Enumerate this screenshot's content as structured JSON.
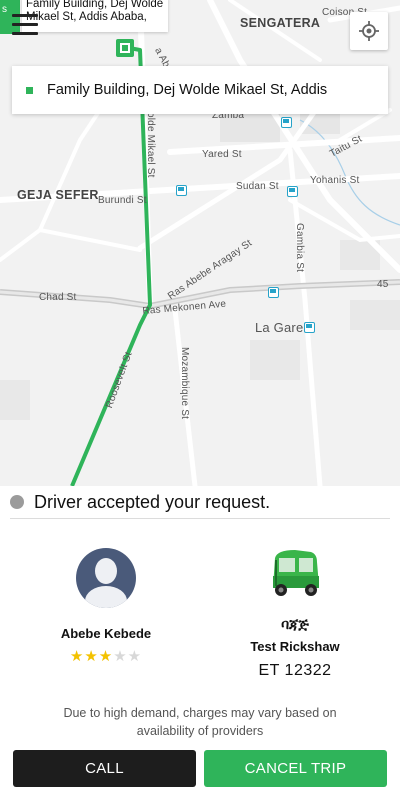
{
  "map": {
    "top_bubble_text": "Family Building, Dej Wolde Mikael St, Addis Ababa,",
    "green_tab_text": "s",
    "labels": {
      "sengatera": "SENGATERA",
      "coison": "Coison St",
      "geja_sefer": "GEJA SEFER",
      "yared": "Yared St",
      "taitu": "Taitu St",
      "sudan": "Sudan St",
      "yohanis": "Yohanis St",
      "burundi": "Burundi St",
      "wolde_mikael": "olde Mikael St",
      "gambia": "Gambia St",
      "ras_abebe": "Ras Abebe Aragay St",
      "chad": "Chad St",
      "ras_mekonen": "Ras Mekonen Ave",
      "route_45": "45",
      "la_gare": "La Gare",
      "mozambique": "Mozambique St",
      "roosevelt": "Roosevelt St",
      "aba_k": "a Aba K",
      "zamba": "Zamba"
    }
  },
  "pickup": {
    "address": "Family Building, Dej Wolde Mikael St, Addis"
  },
  "status": {
    "text": "Driver accepted your request."
  },
  "driver": {
    "name": "Abebe Kebede",
    "rating": 3,
    "max_rating": 5
  },
  "vehicle": {
    "type_amharic": "ባጃጅ",
    "name": "Test Rickshaw",
    "plate": "ET 12322"
  },
  "notice": "Due to high demand, charges may vary based on availability of providers",
  "buttons": {
    "call": "CALL",
    "cancel": "CANCEL TRIP"
  },
  "colors": {
    "accent": "#2fb45a",
    "call_button": "#1d1d1d",
    "star_on": "#f3c200",
    "star_off": "#d8d8d8",
    "bus_stop": "#27a3c9"
  },
  "icons": {
    "menu": "hamburger-icon",
    "locate": "crosshair-icon",
    "avatar": "user-avatar-icon",
    "vehicle": "rickshaw-icon",
    "bus_stop": "bus-stop-icon",
    "pickup": "pickup-marker-icon",
    "star": "star-icon"
  }
}
